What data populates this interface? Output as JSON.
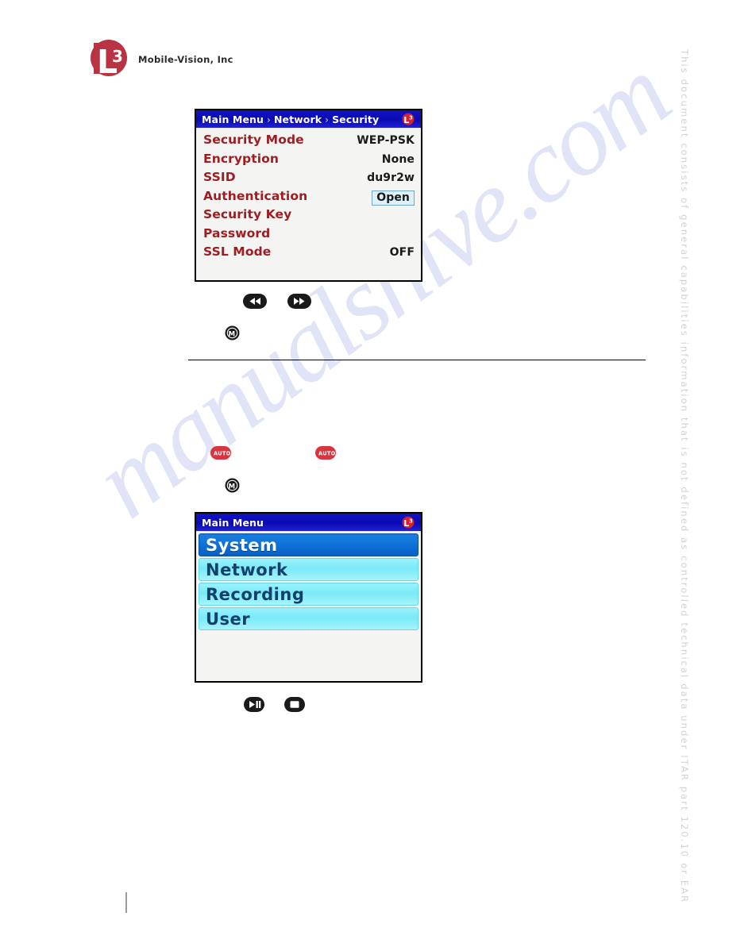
{
  "brand": {
    "logo_icon": "l3-logo-icon",
    "logo_letter": "L",
    "logo_superscript": "3",
    "company_name": "Mobile-Vision, Inc"
  },
  "itar_notice": {
    "text": "This document consists of general capabilities information that is not defined as controlled technical data under  ITAR part 120.10 or EAR"
  },
  "watermark": {
    "text": "manualshive.com"
  },
  "security_screen": {
    "breadcrumb": {
      "root": "Main Menu",
      "level2": "Network",
      "level3": "Security",
      "separator": "›"
    },
    "badge_icon": "l3-badge-icon",
    "rows": [
      {
        "label": "Security Mode",
        "value": "WEP-PSK",
        "highlighted": false
      },
      {
        "label": "Encryption",
        "value": "None",
        "highlighted": false
      },
      {
        "label": "SSID",
        "value": "du9r2w",
        "highlighted": false
      },
      {
        "label": "Authentication",
        "value": "Open",
        "highlighted": true
      },
      {
        "label": "Security Key",
        "value": "",
        "highlighted": false
      },
      {
        "label": "Password",
        "value": "",
        "highlighted": false
      },
      {
        "label": "SSL Mode",
        "value": "OFF",
        "highlighted": false
      }
    ]
  },
  "security_controls": [
    {
      "icon": "rewind-button-icon",
      "label": "Rewind"
    },
    {
      "icon": "fast-forward-button-icon",
      "label": "Fast Forward"
    }
  ],
  "security_menu_button": {
    "icon": "menu-m-button-icon",
    "label": "M"
  },
  "auto_buttons": [
    {
      "icon": "auto-button-icon",
      "label": "AUTO"
    },
    {
      "icon": "auto-button-icon",
      "label": "AUTO"
    }
  ],
  "mainmenu_menu_button": {
    "icon": "menu-m-button-icon",
    "label": "M"
  },
  "main_menu_screen": {
    "title": "Main Menu",
    "badge_icon": "l3-badge-icon",
    "items": [
      {
        "label": "System",
        "selected": true
      },
      {
        "label": "Network",
        "selected": false
      },
      {
        "label": "Recording",
        "selected": false
      },
      {
        "label": "User",
        "selected": false
      }
    ]
  },
  "main_menu_controls": [
    {
      "icon": "play-pause-button-icon",
      "label": "Play/Pause"
    },
    {
      "icon": "stop-button-icon",
      "label": "Stop"
    }
  ],
  "colors": {
    "titlebar_blue": "#0b0bb4",
    "label_red": "#9d1d22",
    "selected_blue": "#0a6ed6",
    "item_cyan": "#7aeaf8",
    "badge_red": "#c8202b",
    "auto_red": "#d9353f",
    "watermark_blue": "#c9cdf0"
  }
}
